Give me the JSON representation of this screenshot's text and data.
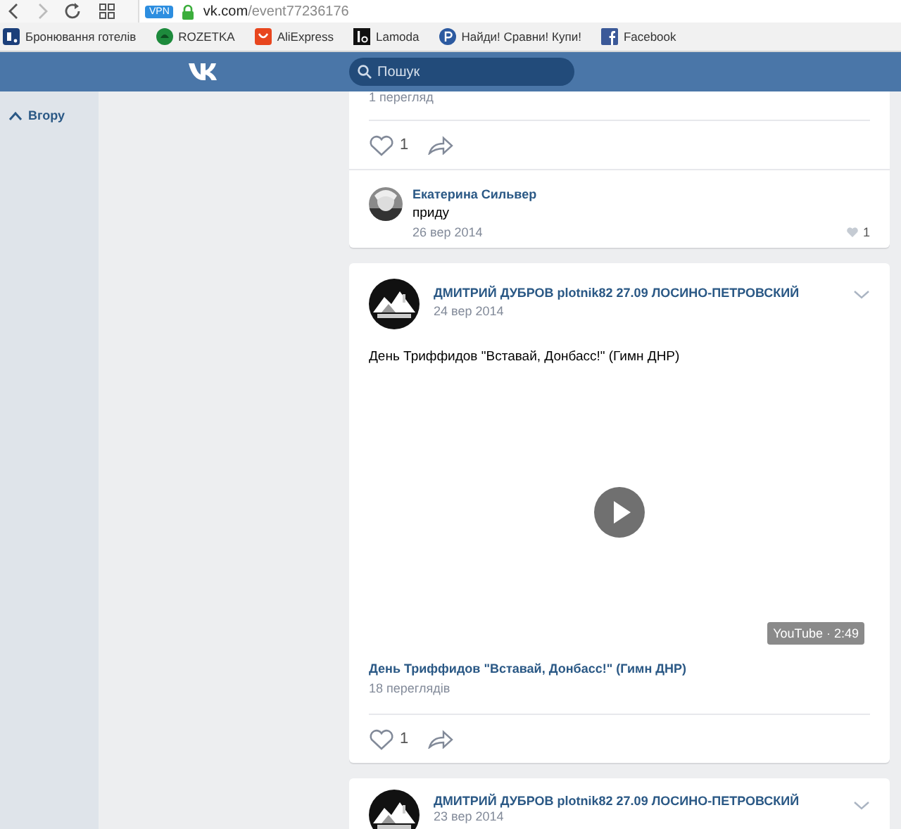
{
  "browser": {
    "vpn": "VPN",
    "url_host": "vk.com",
    "url_path": "/event77236176"
  },
  "bookmarks": [
    {
      "label": "Бронювання готелів",
      "kind": "booking"
    },
    {
      "label": "ROZETKA",
      "kind": "rozetka"
    },
    {
      "label": "AliExpress",
      "kind": "aliexpress"
    },
    {
      "label": "Lamoda",
      "kind": "lamoda"
    },
    {
      "label": "Найди! Сравни! Купи!",
      "kind": "price"
    },
    {
      "label": "Facebook",
      "kind": "facebook"
    }
  ],
  "header": {
    "search": {
      "placeholder": "Пошук"
    }
  },
  "sidebar": {
    "back_to_top": "Вгору"
  },
  "posts": [
    {
      "kind": "partial",
      "views": "1 перегляд",
      "likes": "1",
      "comment": {
        "author": "Екатерина Сильвер",
        "text": "приду",
        "date": "26 вер 2014",
        "likes": "1"
      }
    },
    {
      "kind": "video",
      "author": "ДМИТРИЙ ДУБРОВ plotnik82 27.09 ЛОСИНО-ПЕТРОВСКИЙ",
      "date": "24 вер 2014",
      "text": "День Триффидов \"Вставай, Донбасс!\" (Гимн ДНР)",
      "video": {
        "duration": "YouTube · 2:49",
        "title": "День Триффидов \"Вставай, Донбасс!\" (Гимн ДНР)",
        "views": "18 переглядів"
      },
      "likes": "1"
    },
    {
      "kind": "header_only",
      "author": "ДМИТРИЙ ДУБРОВ plotnik82 27.09 ЛОСИНО-ПЕТРОВСКИЙ",
      "date": "23 вер 2014"
    }
  ]
}
